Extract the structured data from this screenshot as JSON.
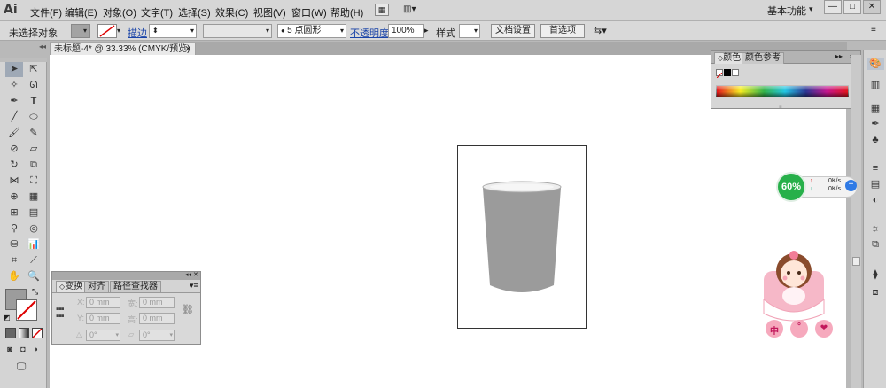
{
  "app": {
    "logo": "Ai",
    "workspace": "基本功能"
  },
  "menu": [
    "文件(F)",
    "编辑(E)",
    "对象(O)",
    "文字(T)",
    "选择(S)",
    "效果(C)",
    "视图(V)",
    "窗口(W)",
    "帮助(H)"
  ],
  "window_controls": {
    "min": "—",
    "max": "□",
    "close": "✕"
  },
  "control": {
    "selection": "未选择对象",
    "stroke_label": "描边",
    "brush": "5 点圆形",
    "opacity_label": "不透明度",
    "opacity_value": "100%",
    "style_label": "样式",
    "doc_setup": "文档设置",
    "prefs": "首选项"
  },
  "document": {
    "tab": "未标题-4* @ 33.33% (CMYK/预览)",
    "close": "✕"
  },
  "transform_panel": {
    "tabs": [
      "变换",
      "对齐",
      "路径查找器"
    ],
    "x_label": "X:",
    "y_label": "Y:",
    "w_label": "宽:",
    "h_label": "高:",
    "x": "0 mm",
    "y": "0 mm",
    "w": "0 mm",
    "h": "0 mm",
    "rotate": "0°",
    "shear": "0°"
  },
  "color_panel": {
    "tabs": [
      "颜色",
      "颜色参考"
    ]
  },
  "net_widget": {
    "percent": "60%",
    "up": "0K/s",
    "down": "0K/s"
  },
  "mascot_text": [
    "中",
    "°",
    "❤"
  ],
  "colors": {
    "cup": "#9b9b9b",
    "cup_rim": "#ededed",
    "menubar": "#d6d6d6",
    "canvas": "#ffffff",
    "widget_green": "#27b04a"
  }
}
